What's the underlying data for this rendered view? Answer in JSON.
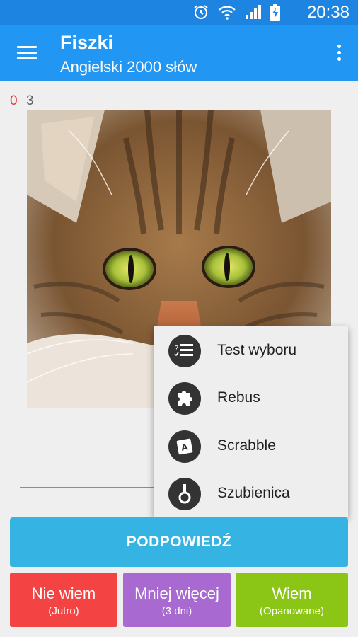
{
  "status_bar": {
    "time": "20:38",
    "icons": [
      "alarm-icon",
      "wifi-icon",
      "signal-icon",
      "battery-charging-icon"
    ]
  },
  "app_bar": {
    "title": "Fiszki",
    "subtitle": "Angielski 2000 słów",
    "menu_icon": "hamburger-menu-icon",
    "overflow_icon": "more-vert-icon"
  },
  "counters": {
    "wrong": "0",
    "total": "3",
    "wrong_color": "#e53935"
  },
  "card": {
    "image": "cat-photo"
  },
  "popup_menu": {
    "items": [
      {
        "label": "Test wyboru",
        "icon": "choice-test-icon"
      },
      {
        "label": "Rebus",
        "icon": "puzzle-icon"
      },
      {
        "label": "Scrabble",
        "icon": "scrabble-tile-icon"
      },
      {
        "label": "Szubienica",
        "icon": "hangman-icon"
      }
    ]
  },
  "hint_button": {
    "label": "PODPOWIEDŹ",
    "color": "#35b3e2"
  },
  "answer_buttons": [
    {
      "label": "Nie wiem",
      "sub": "(Jutro)",
      "color": "#f44343"
    },
    {
      "label": "Mniej więcej",
      "sub": "(3 dni)",
      "color": "#a86ad0"
    },
    {
      "label": "Wiem",
      "sub": "(Opanowane)",
      "color": "#8bc516"
    }
  ]
}
